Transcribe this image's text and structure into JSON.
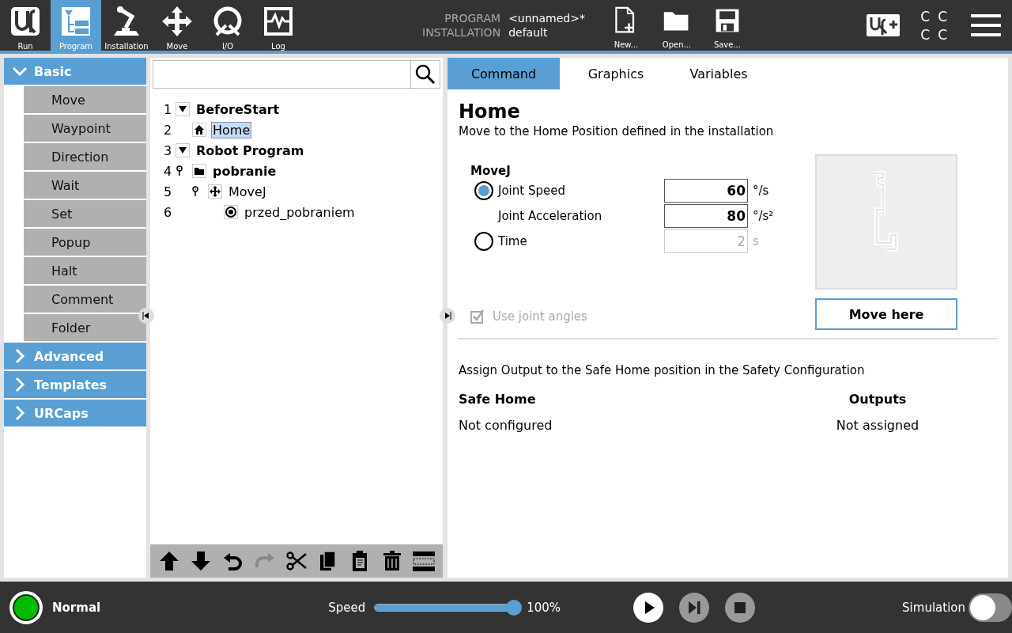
{
  "header": {
    "nav": [
      {
        "label": "Run",
        "selected": false
      },
      {
        "label": "Program",
        "selected": true
      },
      {
        "label": "Installation",
        "selected": false
      },
      {
        "label": "Move",
        "selected": false
      },
      {
        "label": "I/O",
        "selected": false
      },
      {
        "label": "Log",
        "selected": false
      }
    ],
    "program_label": "PROGRAM",
    "program_name": "<unnamed>*",
    "installation_label": "INSTALLATION",
    "installation_name": "default",
    "file_buttons": [
      {
        "label": "New..."
      },
      {
        "label": "Open..."
      },
      {
        "label": "Save..."
      }
    ],
    "status_letters": [
      "C",
      "C",
      "C",
      "C"
    ]
  },
  "sidebar": {
    "groups": [
      {
        "label": "Basic",
        "expanded": true,
        "items": [
          "Move",
          "Waypoint",
          "Direction",
          "Wait",
          "Set",
          "Popup",
          "Halt",
          "Comment",
          "Folder"
        ]
      },
      {
        "label": "Advanced",
        "expanded": false
      },
      {
        "label": "Templates",
        "expanded": false
      },
      {
        "label": "URCaps",
        "expanded": false
      }
    ]
  },
  "tree": [
    {
      "number": "1",
      "label": "BeforeStart",
      "kind": "section",
      "expanded": true,
      "selected": false,
      "children": [
        {
          "number": "2",
          "label": "Home",
          "kind": "home",
          "expanded": false,
          "selected": true
        }
      ]
    },
    {
      "number": "3",
      "label": "Robot Program",
      "kind": "section",
      "expanded": true,
      "selected": false,
      "children": [
        {
          "number": "4",
          "label": "pobranie",
          "kind": "folder",
          "expanded": true,
          "selected": false,
          "children": [
            {
              "number": "5",
              "label": "MoveJ",
              "kind": "move",
              "expanded": true,
              "selected": false,
              "children": [
                {
                  "number": "6",
                  "label": "przed_pobraniem",
                  "kind": "waypoint",
                  "expanded": false,
                  "selected": false
                }
              ]
            }
          ]
        }
      ]
    }
  ],
  "tree_toolbar": [
    {
      "disabled": false
    },
    {
      "disabled": false
    },
    {
      "disabled": false
    },
    {
      "disabled": true
    },
    {
      "disabled": false
    },
    {
      "disabled": false
    },
    {
      "disabled": false
    },
    {
      "disabled": false
    },
    {
      "disabled": false
    }
  ],
  "tabs": [
    {
      "label": "Command",
      "selected": true
    },
    {
      "label": "Graphics",
      "selected": false
    },
    {
      "label": "Variables",
      "selected": false
    }
  ],
  "command": {
    "title": "Home",
    "description": "Move to the Home Position defined in the installation",
    "group_title": "MoveJ",
    "params": [
      {
        "kind": "radio",
        "label": "Joint Speed",
        "selected": true,
        "value": "60",
        "unit": "°/s",
        "disabled": false
      },
      {
        "kind": "plain",
        "label": "Joint Acceleration",
        "value": "80",
        "unit": "°/s²",
        "disabled": false
      },
      {
        "kind": "radio",
        "label": "Time",
        "selected": false,
        "value": "2",
        "unit": "s",
        "disabled": true
      }
    ],
    "checkbox": {
      "label": "Use joint angles",
      "checked": true,
      "disabled": true
    },
    "move_button": "Move here",
    "safety_note": "Assign Output to the Safe Home position in the Safety Configuration",
    "table": {
      "columns": [
        "Safe Home",
        "Outputs"
      ],
      "rows": [
        [
          "Not configured",
          "Not assigned"
        ]
      ]
    }
  },
  "footer": {
    "status": "Normal",
    "speed_label": "Speed",
    "speed": {
      "level": 1,
      "reading": "100%"
    },
    "controls": [
      {
        "disabled": false
      },
      {
        "disabled": true
      },
      {
        "disabled": true
      }
    ],
    "simulation": {
      "label": "Simulation",
      "on": false
    }
  }
}
